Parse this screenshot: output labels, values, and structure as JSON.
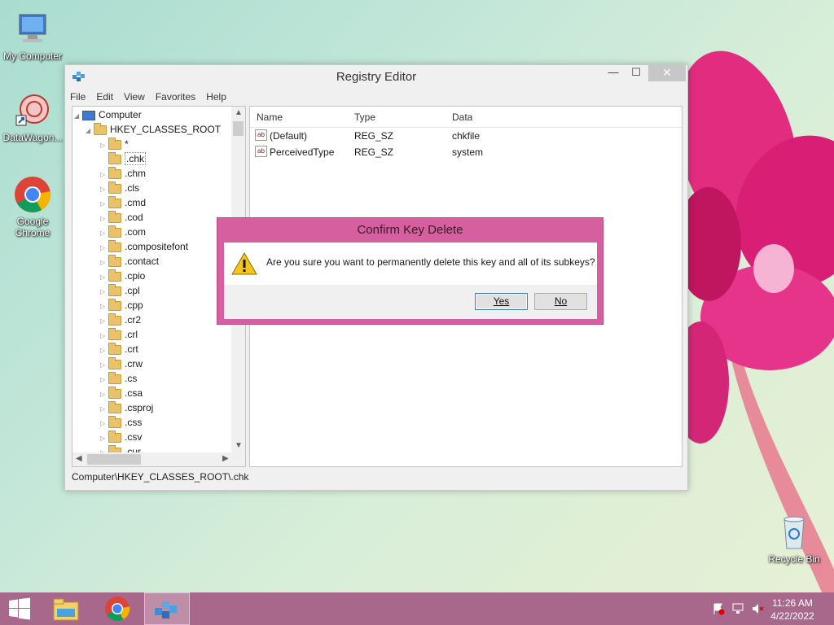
{
  "desktop": {
    "icons": [
      {
        "label": "My Computer"
      },
      {
        "label": "DataWagon..."
      },
      {
        "label": "Google Chrome"
      },
      {
        "label": "Recycle Bin"
      }
    ]
  },
  "window": {
    "title": "Registry Editor",
    "menu": [
      "File",
      "Edit",
      "View",
      "Favorites",
      "Help"
    ],
    "tree": {
      "root": "Computer",
      "hive": "HKEY_CLASSES_ROOT",
      "items": [
        "*",
        ".chk",
        ".chm",
        ".cls",
        ".cmd",
        ".cod",
        ".com",
        ".compositefont",
        ".contact",
        ".cpio",
        ".cpl",
        ".cpp",
        ".cr2",
        ".crl",
        ".crt",
        ".crw",
        ".cs",
        ".csa",
        ".csproj",
        ".css",
        ".csv",
        ".cur"
      ],
      "selected": ".chk"
    },
    "list": {
      "columns": [
        "Name",
        "Type",
        "Data"
      ],
      "rows": [
        {
          "name": "(Default)",
          "type": "REG_SZ",
          "data": "chkfile"
        },
        {
          "name": "PerceivedType",
          "type": "REG_SZ",
          "data": "system"
        }
      ]
    },
    "status": "Computer\\HKEY_CLASSES_ROOT\\.chk"
  },
  "dialog": {
    "title": "Confirm Key Delete",
    "message": "Are you sure you want to permanently delete this key and all of its subkeys?",
    "yes_label": "Yes",
    "no_label": "No"
  },
  "taskbar": {
    "time": "11:26 AM",
    "date": "4/22/2022"
  },
  "colors": {
    "dialog_frame": "#d6609f",
    "taskbar": "#a8688c"
  }
}
